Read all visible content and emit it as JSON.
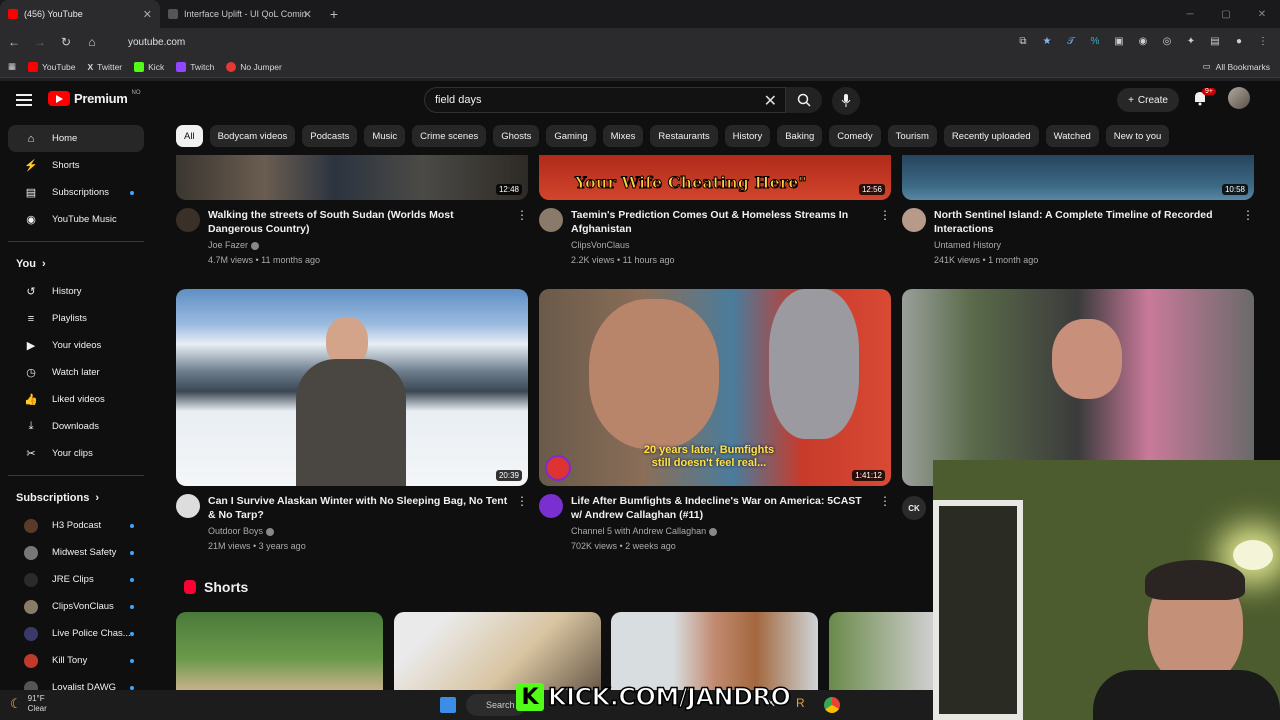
{
  "browser": {
    "tabs": [
      {
        "title": "(456) YouTube",
        "active": true
      },
      {
        "title": "Interface Uplift - UI QoL Comin",
        "active": false
      }
    ],
    "url": "youtube.com",
    "bookmarks": [
      "YouTube",
      "Twitter",
      "Kick",
      "Twitch",
      "No Jumper"
    ],
    "all_bookmarks": "All Bookmarks"
  },
  "header": {
    "logo": "Premium",
    "logo_region": "NO",
    "search_value": "field days",
    "create_label": "Create",
    "notif_count": "9+"
  },
  "sidebar": {
    "main": [
      {
        "label": "Home",
        "icon": "home-icon"
      },
      {
        "label": "Shorts",
        "icon": "shorts-icon"
      },
      {
        "label": "Subscriptions",
        "icon": "subscriptions-icon"
      },
      {
        "label": "YouTube Music",
        "icon": "music-icon"
      }
    ],
    "you_title": "You",
    "you": [
      {
        "label": "History",
        "icon": "history-icon"
      },
      {
        "label": "Playlists",
        "icon": "playlists-icon"
      },
      {
        "label": "Your videos",
        "icon": "your-videos-icon"
      },
      {
        "label": "Watch later",
        "icon": "watch-later-icon"
      },
      {
        "label": "Liked videos",
        "icon": "liked-icon"
      },
      {
        "label": "Downloads",
        "icon": "downloads-icon"
      },
      {
        "label": "Your clips",
        "icon": "clips-icon"
      }
    ],
    "subs_title": "Subscriptions",
    "subs": [
      {
        "label": "H3 Podcast",
        "color": "#5a3b2a"
      },
      {
        "label": "Midwest Safety",
        "color": "#777777"
      },
      {
        "label": "JRE Clips",
        "color": "#2a2a2a"
      },
      {
        "label": "ClipsVonClaus",
        "color": "#8a7a6a"
      },
      {
        "label": "Live Police Chas...",
        "color": "#3a3a6a"
      },
      {
        "label": "Kill Tony",
        "color": "#c0392b"
      },
      {
        "label": "Loyalist DAWG",
        "color": "#555555"
      }
    ]
  },
  "chips": [
    "All",
    "Bodycam videos",
    "Podcasts",
    "Music",
    "Crime scenes",
    "Ghosts",
    "Gaming",
    "Mixes",
    "Restaurants",
    "History",
    "Baking",
    "Comedy",
    "Tourism",
    "Recently uploaded",
    "Watched",
    "New to you"
  ],
  "videos_row1": [
    {
      "title": "Walking the streets of South Sudan (Worlds Most Dangerous Country)",
      "channel": "Joe Fazer",
      "meta": "4.7M views • 11 months ago",
      "duration": "12:48"
    },
    {
      "title": "Taemin's Prediction Comes Out & Homeless Streams In Afghanistan",
      "channel": "ClipsVonClaus",
      "meta": "2.2K views • 11 hours ago",
      "duration": "12:56",
      "thumb_text": "Your Wife Cheating Here\""
    },
    {
      "title": "North Sentinel Island: A Complete Timeline of Recorded Interactions",
      "channel": "Untamed History",
      "meta": "241K views • 1 month ago",
      "duration": "10:58"
    }
  ],
  "videos_row2": [
    {
      "title": "Can I Survive Alaskan Winter with No Sleeping Bag, No Tent & No Tarp?",
      "channel": "Outdoor Boys",
      "meta": "21M views • 3 years ago",
      "duration": "20:39"
    },
    {
      "title": "Life After Bumfights & Indecline's War on America: 5CAST w/ Andrew Callaghan (#11)",
      "channel": "Channel 5 with Andrew Callaghan",
      "meta": "702K views • 2 weeks ago",
      "duration": "1:41:12",
      "thumb_caption": "20 years later, Bumfights still doesn't feel real..."
    },
    {
      "title": "",
      "channel": "",
      "meta": "",
      "duration": ""
    }
  ],
  "shorts_title": "Shorts",
  "third_row2_badge": "CK",
  "taskbar": {
    "temp": "91°F",
    "condition": "Clear",
    "search": "Search"
  },
  "overlay": {
    "kick_url": "KICK.COM/JANDRO"
  }
}
